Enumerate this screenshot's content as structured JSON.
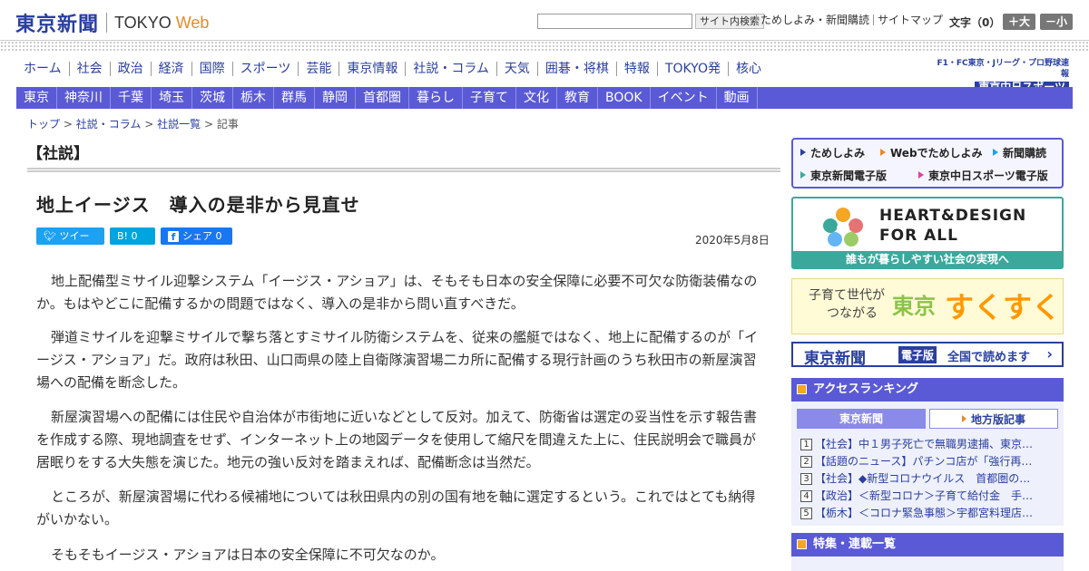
{
  "header": {
    "logo_main": "東京新聞",
    "logo_tokyo": "TOKYO",
    "logo_web": "Web",
    "search_placeholder": "",
    "search_button": "サイト内検索",
    "top_links": [
      "ためしよみ・新聞購読",
      "サイトマップ"
    ],
    "font_size_label": "文字（0）",
    "font_bigger": "＋大",
    "font_smaller": "－小"
  },
  "nav_primary": [
    "ホーム",
    "社会",
    "政治",
    "経済",
    "国際",
    "スポーツ",
    "芸能",
    "東京情報",
    "社説・コラム",
    "天気",
    "囲碁・将棋",
    "特報",
    "TOKYO発",
    "核心"
  ],
  "chunichi": {
    "tagline": "F1・FC東京・Jリーグ・プロ野球速報",
    "logo": "東京中日スポーツ"
  },
  "nav_regional": [
    "東京",
    "神奈川",
    "千葉",
    "埼玉",
    "茨城",
    "栃木",
    "群馬",
    "静岡",
    "首都圏",
    "暮らし",
    "子育て",
    "文化",
    "教育",
    "BOOK",
    "イベント",
    "動画"
  ],
  "breadcrumb": {
    "items": [
      "トップ",
      "社説・コラム",
      "社説一覧"
    ],
    "current": "記事",
    "separator": ">"
  },
  "article": {
    "section": "【社説】",
    "title": "地上イージス　導入の是非から見直せ",
    "tweet_label": "ツイート",
    "hatena_label": "B!  0",
    "share_label": "シェア 0",
    "date": "2020年5月8日",
    "paragraphs": [
      "地上配備型ミサイル迎撃システム「イージス・アショア」は、そもそも日本の安全保障に必要不可欠な防衛装備なのか。もはやどこに配備するかの問題ではなく、導入の是非から問い直すべきだ。",
      "弾道ミサイルを迎撃ミサイルで撃ち落とすミサイル防衛システムを、従来の艦艇ではなく、地上に配備するのが「イージス・アショア」だ。政府は秋田、山口両県の陸上自衛隊演習場二カ所に配備する現行計画のうち秋田市の新屋演習場への配備を断念した。",
      "新屋演習場への配備には住民や自治体が市街地に近いなどとして反対。加えて、防衛省は選定の妥当性を示す報告書を作成する際、現地調査をせず、インターネット上の地図データを使用して縮尺を間違えた上に、住民説明会で職員が居眠りをする大失態を演じた。地元の強い反対を踏まえれば、配備断念は当然だ。",
      "ところが、新屋演習場に代わる候補地については秋田県内の別の国有地を軸に選定するという。これではとても納得がいかない。",
      "そもそもイージス・アショアは日本の安全保障に不可欠なのか。"
    ]
  },
  "sidebar": {
    "quick_links": [
      "ためしよみ",
      "Webでためしよみ",
      "新聞購読",
      "東京新聞電子版",
      "東京中日スポーツ電子版"
    ],
    "heart_title_1": "HEART&DESIGN",
    "heart_title_2": "FOR ALL",
    "heart_sub": "誰もが暮らしやすい社会の実現へ",
    "sukusuku_line1": "子育て世代が",
    "sukusuku_line2": "つながる",
    "sukusuku_tokyo": "東京",
    "sukusuku_main": "すくすく",
    "denshi_logo": "東京新聞",
    "denshi_badge": "電子版",
    "denshi_text": "全国で読めます",
    "ranking_title": "アクセスランキング",
    "ranking_tab_1": "東京新聞",
    "ranking_tab_2": "地方版記事",
    "ranking": [
      {
        "n": "1",
        "text": "【社会】中１男子死亡で無職男逮捕、東京…"
      },
      {
        "n": "2",
        "text": "【話題のニュース】パチンコ店が「強行再…"
      },
      {
        "n": "3",
        "text": "【社会】◆新型コロナウイルス　首都圏の…"
      },
      {
        "n": "4",
        "text": "【政治】＜新型コロナ＞子育て給付金　手…"
      },
      {
        "n": "5",
        "text": "【栃木】＜コロナ緊急事態＞宇都宮料理店…"
      }
    ],
    "special_title": "特集・連載一覧"
  },
  "colors": {
    "brand_blue": "#2a3f9f",
    "nav_blue": "#5a5ad6",
    "accent_orange": "#e8892b",
    "twitter": "#1da1f2",
    "hatena": "#00a4de",
    "facebook": "#1877f2",
    "heart_green": "#3aa99c"
  }
}
